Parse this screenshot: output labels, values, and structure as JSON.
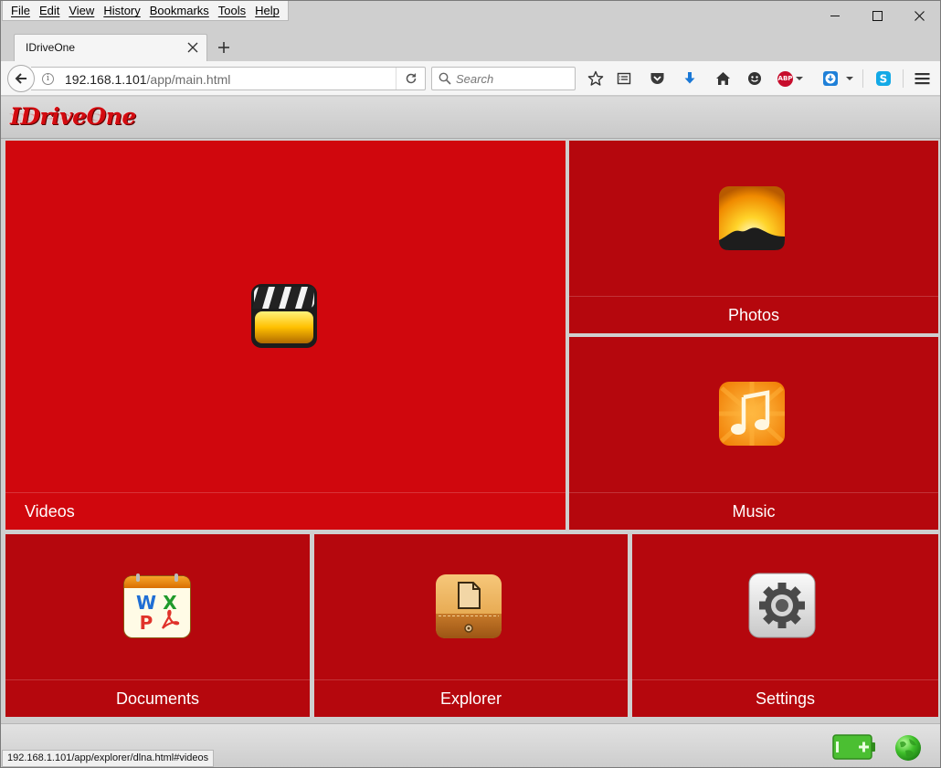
{
  "menubar": {
    "items": [
      "File",
      "Edit",
      "View",
      "History",
      "Bookmarks",
      "Tools",
      "Help"
    ]
  },
  "window_controls": {
    "minimize_icon": "minimize-icon",
    "maximize_icon": "maximize-icon",
    "close_icon": "close-icon"
  },
  "tab": {
    "title": "IDriveOne"
  },
  "navbar": {
    "url_host": "192.168.1.101",
    "url_path": "/app/main.html",
    "search_placeholder": "Search"
  },
  "toolbar_icons": [
    "bookmark-star-icon",
    "reading-list-icon",
    "pocket-icon",
    "download-icon",
    "home-icon",
    "emoji-icon",
    "adblock-plus-icon",
    "download-manager-icon",
    "skype-icon",
    "hamburger-menu-icon"
  ],
  "adblock_label": "ABP",
  "app": {
    "logo": "IDriveOne",
    "tiles": [
      {
        "id": "videos",
        "label": "Videos",
        "icon": "clapperboard-icon"
      },
      {
        "id": "photos",
        "label": "Photos",
        "icon": "sunset-photo-icon"
      },
      {
        "id": "music",
        "label": "Music",
        "icon": "music-note-icon"
      },
      {
        "id": "documents",
        "label": "Documents",
        "icon": "documents-icon",
        "icon_letters": [
          "W",
          "X",
          "P"
        ]
      },
      {
        "id": "explorer",
        "label": "Explorer",
        "icon": "file-explorer-icon"
      },
      {
        "id": "settings",
        "label": "Settings",
        "icon": "gear-icon"
      }
    ]
  },
  "colors": {
    "tile_primary": "#d0070d",
    "tile_secondary": "#b5070d",
    "logo": "#d40b10"
  },
  "statusbar": {
    "hover_url": "192.168.1.101/app/explorer/dlna.html#videos"
  }
}
